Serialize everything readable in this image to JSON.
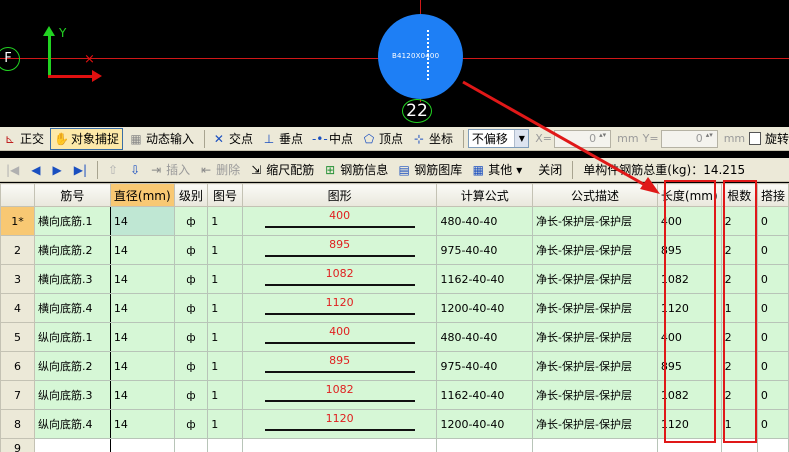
{
  "viewport": {
    "axis_y_label": "Y",
    "axis_x_mark": "×",
    "origin_label": "F",
    "section_text": "B4120X0400",
    "bubble_label": "22"
  },
  "toolbar1": {
    "items": [
      {
        "id": "ortho",
        "label": "正交",
        "icon": "ortho-icon"
      },
      {
        "id": "snap",
        "label": "对象捕捉",
        "icon": "hand-icon",
        "active": true
      },
      {
        "id": "dyn",
        "label": "动态输入",
        "icon": "dynamic-input-icon"
      },
      {
        "id": "intersect",
        "label": "交点",
        "icon": "intersection-icon"
      },
      {
        "id": "perp",
        "label": "垂点",
        "icon": "perpendicular-icon"
      },
      {
        "id": "mid",
        "label": "中点",
        "icon": "midpoint-icon"
      },
      {
        "id": "vertex",
        "label": "顶点",
        "icon": "vertex-icon"
      },
      {
        "id": "coord",
        "label": "坐标",
        "icon": "coordinate-icon"
      }
    ],
    "offset_select": "不偏移",
    "x_label": "X=",
    "x_value": "0",
    "y_label": "Y=",
    "y_value": "0",
    "unit": "mm",
    "rotate_label": "旋转"
  },
  "toolbar2": {
    "insert_label": "插入",
    "delete_label": "删除",
    "scale_label": "缩尺配筋",
    "info_label": "钢筋信息",
    "library_label": "钢筋图库",
    "other_label": "其他",
    "close_label": "关闭",
    "total_label": "单构件钢筋总重(kg)：14.215"
  },
  "grid": {
    "columns": [
      "",
      "筋号",
      "直径(mm)",
      "级别",
      "图号",
      "图形",
      "计算公式",
      "公式描述",
      "长度(mm)",
      "根数",
      "搭接"
    ],
    "rows": [
      {
        "num": "1*",
        "name": "横向底筋.1",
        "dia": "14",
        "grade": "ф",
        "fig": "1",
        "shape": "400",
        "formula": "480-40-40",
        "desc": "净长-保护层-保护层",
        "length": "400",
        "count": "2",
        "lap": "0"
      },
      {
        "num": "2",
        "name": "横向底筋.2",
        "dia": "14",
        "grade": "ф",
        "fig": "1",
        "shape": "895",
        "formula": "975-40-40",
        "desc": "净长-保护层-保护层",
        "length": "895",
        "count": "2",
        "lap": "0"
      },
      {
        "num": "3",
        "name": "横向底筋.3",
        "dia": "14",
        "grade": "ф",
        "fig": "1",
        "shape": "1082",
        "formula": "1162-40-40",
        "desc": "净长-保护层-保护层",
        "length": "1082",
        "count": "2",
        "lap": "0"
      },
      {
        "num": "4",
        "name": "横向底筋.4",
        "dia": "14",
        "grade": "ф",
        "fig": "1",
        "shape": "1120",
        "formula": "1200-40-40",
        "desc": "净长-保护层-保护层",
        "length": "1120",
        "count": "1",
        "lap": "0"
      },
      {
        "num": "5",
        "name": "纵向底筋.1",
        "dia": "14",
        "grade": "ф",
        "fig": "1",
        "shape": "400",
        "formula": "480-40-40",
        "desc": "净长-保护层-保护层",
        "length": "400",
        "count": "2",
        "lap": "0"
      },
      {
        "num": "6",
        "name": "纵向底筋.2",
        "dia": "14",
        "grade": "ф",
        "fig": "1",
        "shape": "895",
        "formula": "975-40-40",
        "desc": "净长-保护层-保护层",
        "length": "895",
        "count": "2",
        "lap": "0"
      },
      {
        "num": "7",
        "name": "纵向底筋.3",
        "dia": "14",
        "grade": "ф",
        "fig": "1",
        "shape": "1082",
        "formula": "1162-40-40",
        "desc": "净长-保护层-保护层",
        "length": "1082",
        "count": "2",
        "lap": "0"
      },
      {
        "num": "8",
        "name": "纵向底筋.4",
        "dia": "14",
        "grade": "ф",
        "fig": "1",
        "shape": "1120",
        "formula": "1200-40-40",
        "desc": "净长-保护层-保护层",
        "length": "1120",
        "count": "1",
        "lap": "0"
      }
    ],
    "last_row_num": "9"
  },
  "colors": {
    "row_green": "#d6f7d6",
    "annotation_red": "#e01818",
    "section_blue": "#1e7ff5"
  }
}
